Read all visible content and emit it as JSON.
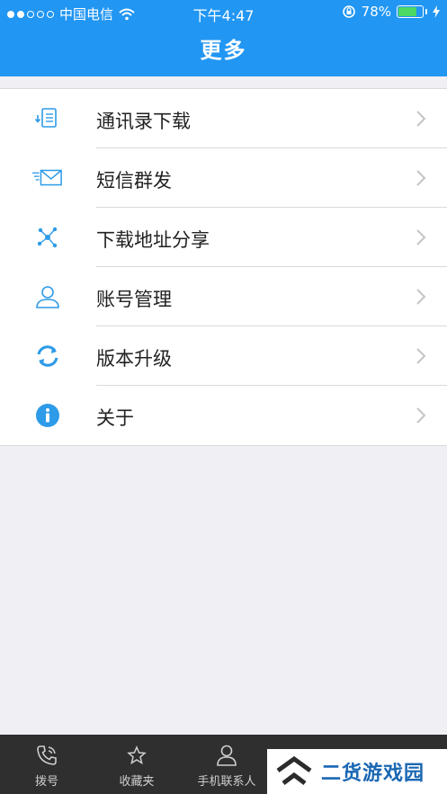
{
  "status": {
    "carrier": "中国电信",
    "time": "下午4:47",
    "battery": "78%",
    "battery_level": 0.78
  },
  "header": {
    "title": "更多"
  },
  "menu": {
    "items": [
      {
        "label": "通讯录下载",
        "icon": "contacts-download-icon"
      },
      {
        "label": "短信群发",
        "icon": "sms-broadcast-icon"
      },
      {
        "label": "下载地址分享",
        "icon": "share-icon"
      },
      {
        "label": "账号管理",
        "icon": "account-icon"
      },
      {
        "label": "版本升级",
        "icon": "refresh-icon"
      },
      {
        "label": "关于",
        "icon": "info-icon"
      }
    ]
  },
  "tabs": [
    {
      "label": "拨号",
      "icon": "phone-icon"
    },
    {
      "label": "收藏夹",
      "icon": "star-icon"
    },
    {
      "label": "手机联系人",
      "icon": "person-icon"
    }
  ],
  "watermark": {
    "text": "二货游戏园"
  },
  "colors": {
    "header_bg": "#2196f3",
    "icon_blue": "#2d9be8",
    "tabbar_bg": "#2f2f2f",
    "page_bg": "#efeff4"
  }
}
